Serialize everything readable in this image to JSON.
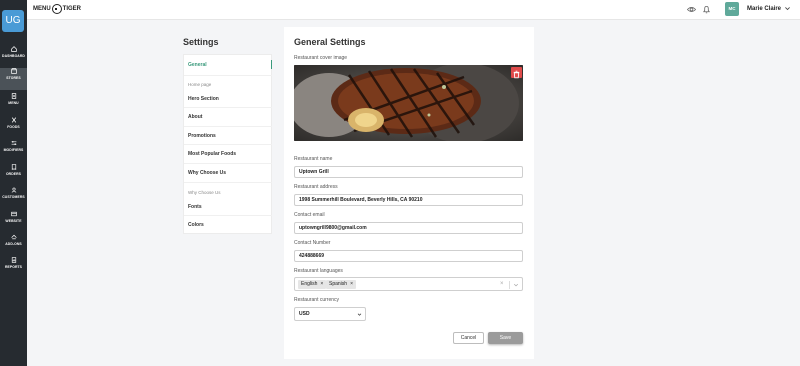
{
  "app": {
    "logo_left": "MENU",
    "logo_right": "TIGER",
    "user_initials": "UG"
  },
  "nav": [
    {
      "label": "DASHBOARD",
      "icon": "home-icon"
    },
    {
      "label": "STORES",
      "icon": "store-icon",
      "active": true
    },
    {
      "label": "MENU",
      "icon": "menu-book-icon"
    },
    {
      "label": "FOODS",
      "icon": "fork-knife-icon"
    },
    {
      "label": "MODIFIERS",
      "icon": "sliders-icon"
    },
    {
      "label": "ORDERS",
      "icon": "receipt-icon"
    },
    {
      "label": "CUSTOMERS",
      "icon": "users-icon"
    },
    {
      "label": "WEBSITE",
      "icon": "globe-icon"
    },
    {
      "label": "ADD-ONS",
      "icon": "puzzle-icon"
    },
    {
      "label": "REPORTS",
      "icon": "chart-icon"
    }
  ],
  "header": {
    "avatar_initials": "MC",
    "username": "Marie Claire"
  },
  "settings": {
    "title": "Settings",
    "menu": {
      "general": "General",
      "group_home": "Home page",
      "hero": "Hero Section",
      "about": "About",
      "promotions": "Promotions",
      "popular": "Most Popular Foods",
      "why": "Why Choose Us",
      "group_why": "Why Choose Us",
      "fonts": "Fonts",
      "colors": "Colors"
    }
  },
  "form": {
    "title": "General Settings",
    "cover_label": "Restaurant cover image",
    "name_label": "Restaurant name",
    "name_value": "Uptown Grill",
    "address_label": "Restaurant address",
    "address_value": "1998 Summerhill Boulevard, Beverly Hills, CA 90210",
    "email_label": "Contact email",
    "email_value": "uptowngrill9800@gmail.com",
    "phone_label": "Contact Number",
    "phone_value": "424888669",
    "languages_label": "Restaurant languages",
    "languages": [
      "English",
      "Spanish"
    ],
    "currency_label": "Restaurant currency",
    "currency_value": "USD",
    "cancel": "Cancel",
    "save": "Save"
  },
  "colors": {
    "accent": "#3a9a7c",
    "nav_bg": "#262b30",
    "delete": "#e04b4b"
  }
}
